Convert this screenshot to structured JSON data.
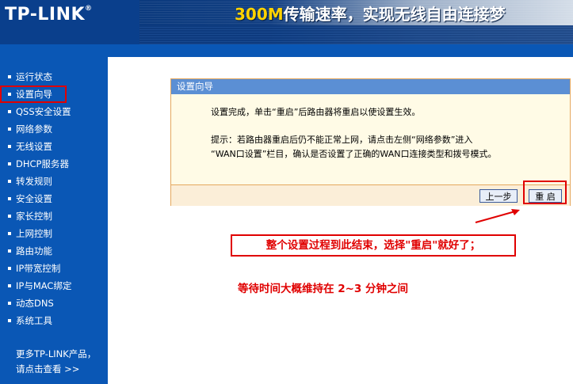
{
  "header": {
    "logo": "TP-LINK",
    "logo_mark": "®",
    "banner_highlight": "300M",
    "banner_text": "传输速率，实现无线自由连接梦"
  },
  "sidebar": {
    "items": [
      {
        "label": "运行状态"
      },
      {
        "label": "设置向导"
      },
      {
        "label": "QSS安全设置"
      },
      {
        "label": "网络参数"
      },
      {
        "label": "无线设置"
      },
      {
        "label": "DHCP服务器"
      },
      {
        "label": "转发规则"
      },
      {
        "label": "安全设置"
      },
      {
        "label": "家长控制"
      },
      {
        "label": "上网控制"
      },
      {
        "label": "路由功能"
      },
      {
        "label": "IP带宽控制"
      },
      {
        "label": "IP与MAC绑定"
      },
      {
        "label": "动态DNS"
      },
      {
        "label": "系统工具"
      }
    ],
    "more_line1": "更多TP-LINK产品，",
    "more_line2": "请点击查看 >>"
  },
  "panel": {
    "title": "设置向导",
    "message": "设置完成，单击“重启”后路由器将重启以使设置生效。",
    "hint_line1": "提示：若路由器重启后仍不能正常上网，请点击左侧“网络参数”进入",
    "hint_line2": "“WAN口设置”栏目，确认是否设置了正确的WAN口连接类型和拨号模式。",
    "prev_button": "上一步",
    "reboot_button": "重 启"
  },
  "annotations": {
    "note1": "整个设置过程到此结束，选择\"重启\"就好了；",
    "note2": "等待时间大概维持在 2~3 分钟之间",
    "highlight_color": "#e00000"
  }
}
